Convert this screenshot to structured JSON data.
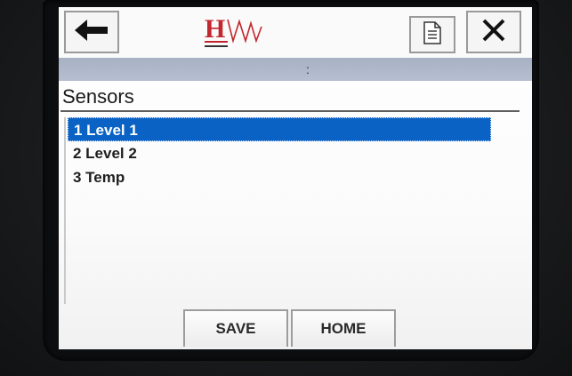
{
  "app": {
    "logo_text": "HW"
  },
  "toolbar": {
    "back_icon": "arrow-left-icon",
    "document_icon": "document-icon",
    "close_icon": "close-icon"
  },
  "status_bar": {
    "text": ":"
  },
  "page": {
    "title": "Sensors"
  },
  "sensors": {
    "items": [
      {
        "label": "1 Level 1",
        "selected": true
      },
      {
        "label": "2 Level 2",
        "selected": false
      },
      {
        "label": "3 Temp",
        "selected": false
      }
    ]
  },
  "footer": {
    "save_label": "SAVE",
    "home_label": "HOME"
  },
  "colors": {
    "selection": "#0a63c4",
    "logo_red": "#c2262e",
    "status_bar": "#aeb8ca"
  }
}
